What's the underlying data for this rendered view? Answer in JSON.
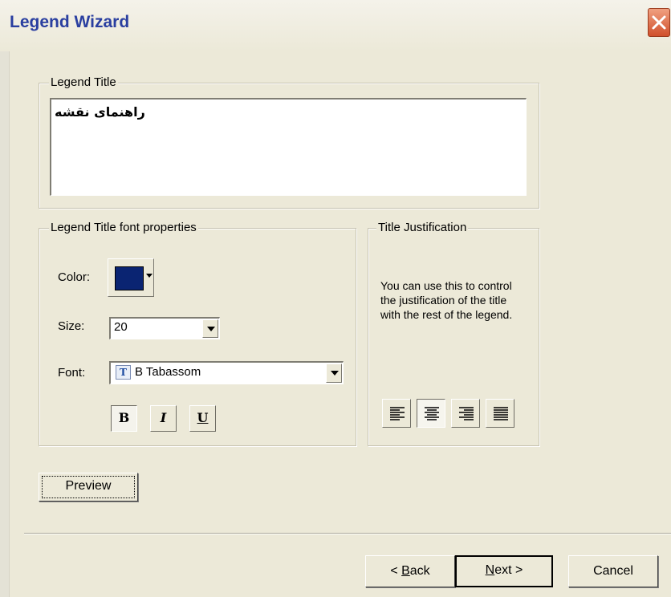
{
  "window": {
    "title": "Legend Wizard",
    "close_label": "×"
  },
  "legend_title": {
    "group_label": "Legend Title",
    "value": "راهنمای نقشه"
  },
  "font_properties": {
    "group_label": "Legend Title font properties",
    "color_label": "Color:",
    "color_value": "#0a2472",
    "size_label": "Size:",
    "size_value": "20",
    "font_label": "Font:",
    "font_value": "B Tabassom",
    "bold_label": "B",
    "italic_label": "I",
    "underline_label": "U"
  },
  "justification": {
    "group_label": "Title Justification",
    "description": "You can use this to control the justification of the title with the rest of the legend.",
    "options": [
      "left-align-icon",
      "center-align-icon",
      "right-align-icon",
      "justify-icon"
    ],
    "selected": "center-align-icon"
  },
  "preview_label": "Preview",
  "footer": {
    "back_prefix": "< ",
    "back_accel": "B",
    "back_rest": "ack",
    "next_accel": "N",
    "next_rest": "ext >",
    "cancel_label": "Cancel"
  }
}
